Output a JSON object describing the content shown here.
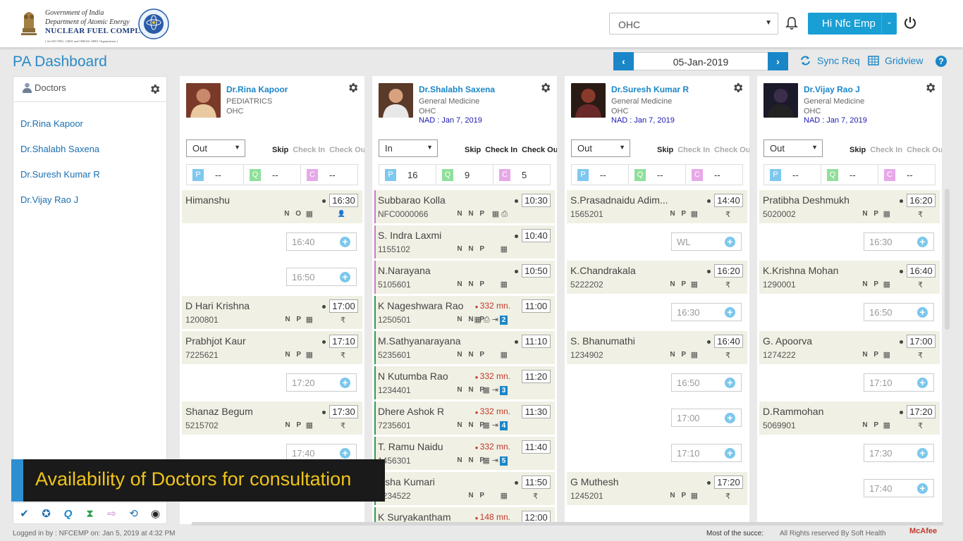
{
  "header": {
    "org_line1": "Government of India",
    "org_line2": "Department of Atomic Energy",
    "org_line3": "NUCLEAR FUEL COMPLEX",
    "org_line4": "( An ISO 9001, 14001 and OHSAS 18001 Organization )",
    "location_select": "OHC",
    "user_label": "Hi Nfc Emp"
  },
  "page": {
    "title": "PA Dashboard",
    "date": "05-Jan-2019",
    "prev": "‹",
    "next": "›",
    "sync_label": "Sync Req",
    "gridview_label": "Gridview",
    "help": "?"
  },
  "sidebar": {
    "heading": "Doctors",
    "doctors": [
      "Dr.Rina Kapoor",
      "Dr.Shalabh Saxena",
      "Dr.Suresh Kumar R",
      "Dr.Vijay Rao J"
    ]
  },
  "labels": {
    "skip": "Skip",
    "check_in": "Check In",
    "check_out": "Check Out",
    "p": "P",
    "q": "Q",
    "c": "C",
    "rupee": "₹",
    "plus": "+"
  },
  "columns": [
    {
      "name": "Dr.Rina Kapoor",
      "dept": "PEDIATRICS",
      "unit": "OHC",
      "nad": "",
      "status": "Out",
      "p": "--",
      "q": "--",
      "c": "--",
      "slots": [
        {
          "type": "patient",
          "name": "Himanshu",
          "id": "",
          "time": "16:30",
          "flags": "N O",
          "wait": "",
          "rupee": false
        },
        {
          "type": "open",
          "time": "16:40"
        },
        {
          "type": "open",
          "time": "16:50"
        },
        {
          "type": "patient",
          "name": "D Hari Krishna",
          "id": "1200801",
          "time": "17:00",
          "flags": "N P",
          "wait": "",
          "rupee": true
        },
        {
          "type": "patient",
          "name": "Prabhjot Kaur",
          "id": "7225621",
          "time": "17:10",
          "flags": "N P",
          "wait": "",
          "rupee": true
        },
        {
          "type": "open",
          "time": "17:20"
        },
        {
          "type": "patient",
          "name": "Shanaz Begum",
          "id": "5215702",
          "time": "17:30",
          "flags": "N P",
          "wait": "",
          "rupee": true
        },
        {
          "type": "open",
          "time": "17:40"
        }
      ]
    },
    {
      "name": "Dr.Shalabh Saxena",
      "dept": "General Medicine",
      "unit": "OHC",
      "nad": "NAD : Jan 7, 2019",
      "status": "In",
      "p": "16",
      "q": "9",
      "c": "5",
      "slots": [
        {
          "type": "patient",
          "name": "Subbarao Kolla",
          "id": "NFC0000066",
          "time": "10:30",
          "flags": "N N P",
          "wait": "",
          "rupee": false,
          "bar": "#c77dc7"
        },
        {
          "type": "patient",
          "name": "S. Indra Laxmi",
          "id": "1155102",
          "time": "10:40",
          "flags": "N N P",
          "wait": "",
          "rupee": false,
          "bar": "#c77dc7"
        },
        {
          "type": "patient",
          "name": "N.Narayana",
          "id": "5105601",
          "time": "10:50",
          "flags": "N N P",
          "wait": "",
          "rupee": false,
          "bar": "#c77dc7"
        },
        {
          "type": "patient",
          "name": "K Nageshwara Rao",
          "id": "1250501",
          "time": "11:00",
          "flags": "N N P",
          "wait": "332 mn.",
          "rupee": false,
          "queue": "2",
          "bar": "#2e9e4f"
        },
        {
          "type": "patient",
          "name": "M.Sathyanarayana",
          "id": "5235601",
          "time": "11:10",
          "flags": "N N P",
          "wait": "",
          "rupee": false,
          "bar": "#2e9e4f"
        },
        {
          "type": "patient",
          "name": "N Kutumba Rao",
          "id": "1234401",
          "time": "11:20",
          "flags": "N N P",
          "wait": "332 mn.",
          "rupee": false,
          "queue": "3",
          "bar": "#2e9e4f"
        },
        {
          "type": "patient",
          "name": "Dhere Ashok R",
          "id": "7235601",
          "time": "11:30",
          "flags": "N N P",
          "wait": "332 mn.",
          "rupee": false,
          "queue": "4",
          "bar": "#2e9e4f"
        },
        {
          "type": "patient",
          "name": "T. Ramu Naidu",
          "id": "1456301",
          "time": "11:40",
          "flags": "N N P",
          "wait": "332 mn.",
          "rupee": false,
          "queue": "5",
          "bar": "#2e9e4f"
        },
        {
          "type": "patient",
          "name": "Usha Kumari",
          "id": "7234522",
          "time": "11:50",
          "flags": "N P",
          "wait": "",
          "rupee": true,
          "bar": "#2e9e4f"
        },
        {
          "type": "patient",
          "name": "K Suryakantham",
          "id": "",
          "time": "12:00",
          "flags": "",
          "wait": "148 mn.",
          "rupee": false,
          "bar": "#2e9e4f"
        }
      ]
    },
    {
      "name": "Dr.Suresh Kumar R",
      "dept": "General Medicine",
      "unit": "OHC",
      "nad": "NAD : Jan 7, 2019",
      "status": "Out",
      "p": "--",
      "q": "--",
      "c": "--",
      "slots": [
        {
          "type": "patient",
          "name": "S.Prasadnaidu Adim...",
          "id": "1565201",
          "time": "14:40",
          "flags": "N P",
          "wait": "",
          "rupee": true
        },
        {
          "type": "open",
          "time": "WL"
        },
        {
          "type": "patient",
          "name": "K.Chandrakala",
          "id": "5222202",
          "time": "16:20",
          "flags": "N P",
          "wait": "",
          "rupee": true
        },
        {
          "type": "open",
          "time": "16:30"
        },
        {
          "type": "patient",
          "name": "S. Bhanumathi",
          "id": "1234902",
          "time": "16:40",
          "flags": "N P",
          "wait": "",
          "rupee": true
        },
        {
          "type": "open",
          "time": "16:50"
        },
        {
          "type": "open",
          "time": "17:00"
        },
        {
          "type": "open",
          "time": "17:10"
        },
        {
          "type": "patient",
          "name": "G Muthesh",
          "id": "1245201",
          "time": "17:20",
          "flags": "N P",
          "wait": "",
          "rupee": true
        }
      ]
    },
    {
      "name": "Dr.Vijay Rao J",
      "dept": "General Medicine",
      "unit": "OHC",
      "nad": "NAD : Jan 7, 2019",
      "status": "Out",
      "p": "--",
      "q": "--",
      "c": "--",
      "slots": [
        {
          "type": "patient",
          "name": "Pratibha Deshmukh",
          "id": "5020002",
          "time": "16:20",
          "flags": "N P",
          "wait": "",
          "rupee": true
        },
        {
          "type": "open",
          "time": "16:30"
        },
        {
          "type": "patient",
          "name": "K.Krishna Mohan",
          "id": "1290001",
          "time": "16:40",
          "flags": "N P",
          "wait": "",
          "rupee": true
        },
        {
          "type": "open",
          "time": "16:50"
        },
        {
          "type": "patient",
          "name": "G. Apoorva",
          "id": "1274222",
          "time": "17:00",
          "flags": "N P",
          "wait": "",
          "rupee": true
        },
        {
          "type": "open",
          "time": "17:10"
        },
        {
          "type": "patient",
          "name": "D.Rammohan",
          "id": "5069901",
          "time": "17:20",
          "flags": "N P",
          "wait": "",
          "rupee": true
        },
        {
          "type": "open",
          "time": "17:30"
        },
        {
          "type": "open",
          "time": "17:40"
        }
      ]
    }
  ],
  "footer": {
    "logged_in": "Logged in by : NFCEMP on: Jan 5, 2019 at 4:32 PM",
    "ticker": "Most of the succe:",
    "rights": "All Rights reserved By Soft Health",
    "mcafee": "McAfee"
  },
  "caption": "Availability of Doctors for consultation",
  "colors": {
    "accent": "#1a86c8",
    "p_badge": "#7ec8ef",
    "q_badge": "#8fdf9a",
    "c_badge": "#e7a8e8",
    "wait": "#c0392b"
  }
}
